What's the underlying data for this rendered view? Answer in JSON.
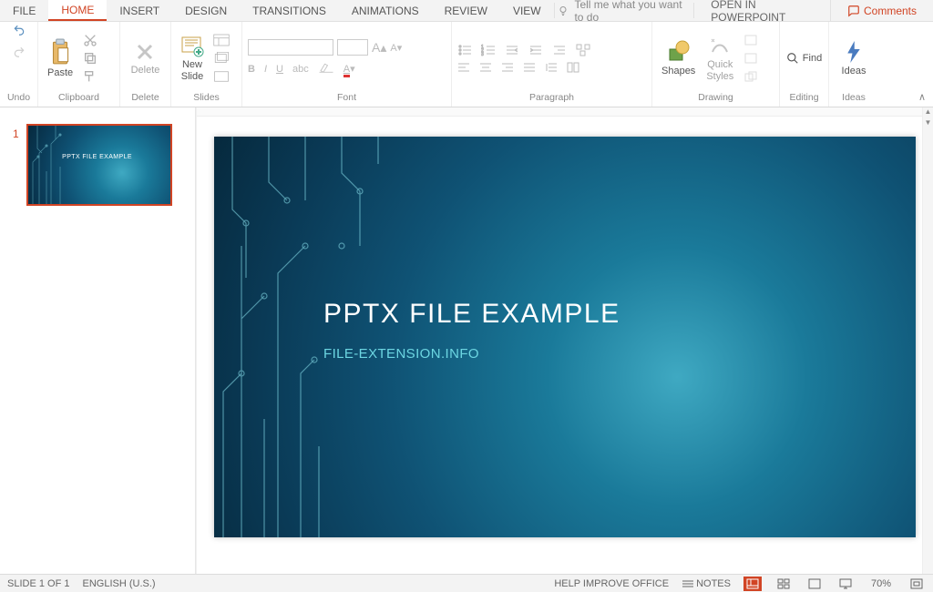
{
  "menu": {
    "tabs": [
      "FILE",
      "HOME",
      "INSERT",
      "DESIGN",
      "TRANSITIONS",
      "ANIMATIONS",
      "REVIEW",
      "VIEW"
    ],
    "active": 1,
    "tell_me": "Tell me what you want to do",
    "open_in": "OPEN IN POWERPOINT",
    "comments": "Comments"
  },
  "ribbon": {
    "undo": "Undo",
    "paste": "Paste",
    "clipboard": "Clipboard",
    "delete": "Delete",
    "delete_group": "Delete",
    "new_slide": "New\nSlide",
    "slides": "Slides",
    "font": "Font",
    "paragraph": "Paragraph",
    "shapes": "Shapes",
    "quick_styles": "Quick\nStyles",
    "drawing": "Drawing",
    "find": "Find",
    "editing": "Editing",
    "ideas": "Ideas",
    "ideas_group": "Ideas"
  },
  "thumbs": {
    "items": [
      {
        "num": "1"
      }
    ]
  },
  "slide": {
    "title": "PPTX FILE EXAMPLE",
    "subtitle": "FILE-EXTENSION.INFO"
  },
  "status": {
    "slide_of": "SLIDE 1 OF 1",
    "language": "ENGLISH (U.S.)",
    "improve": "HELP IMPROVE OFFICE",
    "notes": "NOTES",
    "zoom": "70%"
  }
}
